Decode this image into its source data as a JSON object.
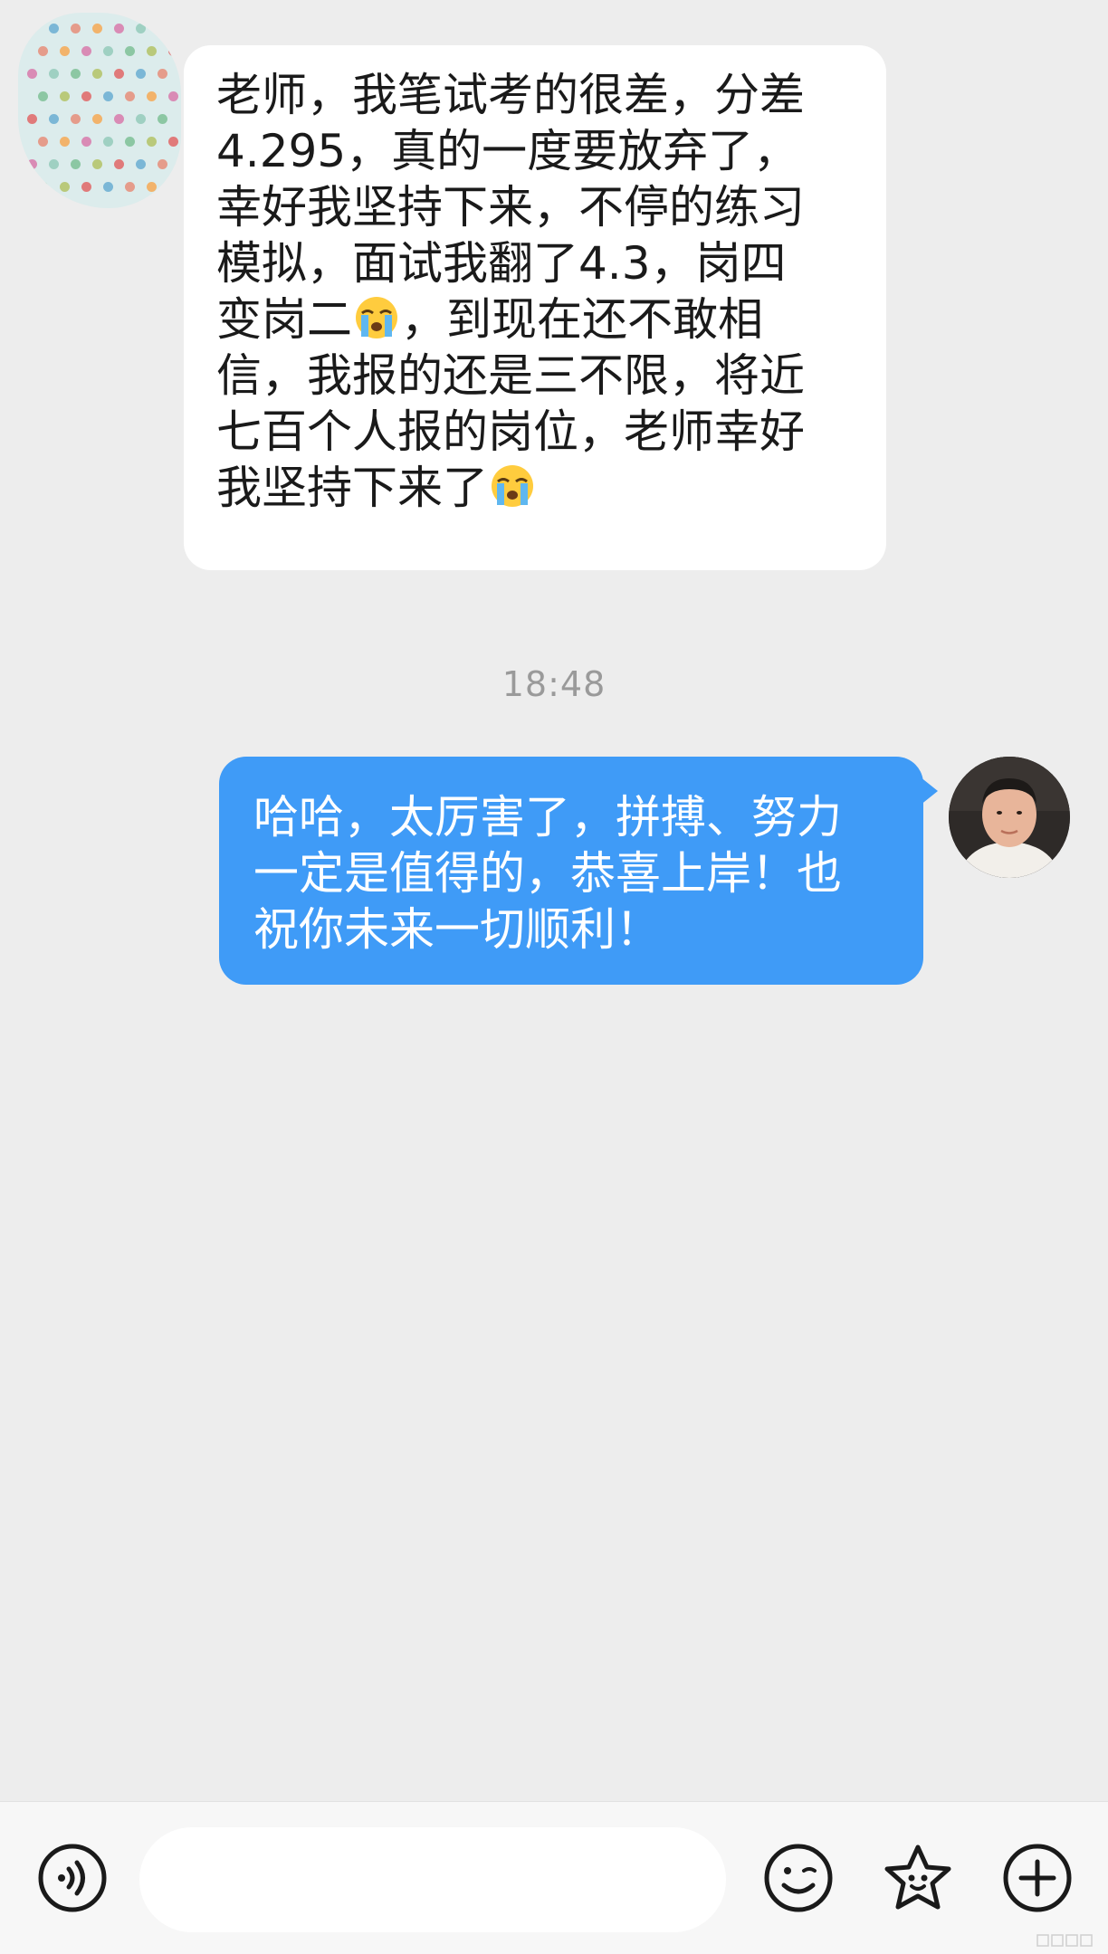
{
  "conversation": {
    "incoming": {
      "lines": [
        "老师，我笔试考的很差，分差",
        "4.295，真的一度要放弃了，",
        "幸好我坚持下来，不停的练习",
        "模拟，面试我翻了4.3，岗四"
      ],
      "line5_before": "变岗二",
      "line5_after": "，到现在还不敢相",
      "line6": "信，我报的还是三不限，将近",
      "line7": "七百个人报的岗位，老师幸好",
      "line8_before": "我坚持下来了",
      "emoji": "loudly-crying-face-icon"
    },
    "timestamp": "18:48",
    "outgoing": {
      "lines": [
        "哈哈，太厉害了，拼搏、努力",
        "一定是值得的，恭喜上岸！也",
        "祝你未来一切顺利！"
      ]
    }
  },
  "input_bar": {
    "voice_icon": "voice-icon",
    "message_placeholder": "",
    "emoji_icon": "emoji-icon",
    "sticker_icon": "sticker-icon",
    "more_icon": "plus-icon"
  },
  "colors": {
    "background": "#ededed",
    "incoming_bubble": "#ffffff",
    "outgoing_bubble": "#3f9bf7",
    "timestamp": "#9a9a9a"
  }
}
